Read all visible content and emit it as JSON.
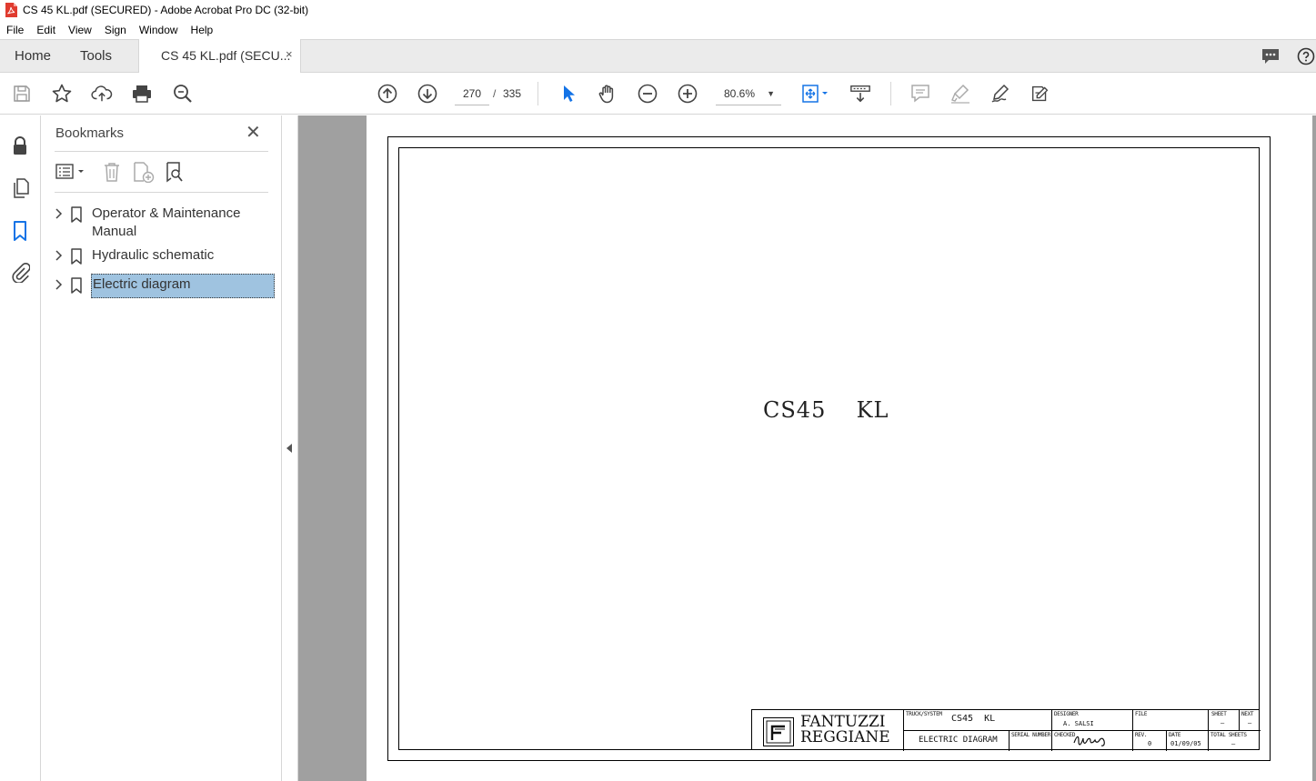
{
  "window": {
    "title": "CS 45 KL.pdf (SECURED) - Adobe Acrobat Pro DC (32-bit)"
  },
  "menu": [
    "File",
    "Edit",
    "View",
    "Sign",
    "Window",
    "Help"
  ],
  "tabs": {
    "home": "Home",
    "tools": "Tools",
    "document": "CS 45 KL.pdf (SECU...",
    "close": "×"
  },
  "toolbar": {
    "current_page": "270",
    "page_separator": "/",
    "total_pages": "335",
    "zoom": "80.6%",
    "icons": [
      "save-icon",
      "star-icon",
      "upload-icon",
      "print-icon",
      "search-zoom-icon",
      "page-up-icon",
      "page-down-icon",
      "select-arrow-icon",
      "hand-icon",
      "zoom-out-icon",
      "zoom-in-icon",
      "fit-page-icon",
      "scroll-mode-icon",
      "comment-icon",
      "highlight-icon",
      "sign-icon",
      "more-tools-icon"
    ]
  },
  "left_rail": {
    "icons": [
      "lock-icon",
      "pages-icon",
      "bookmark-icon",
      "attachment-icon"
    ]
  },
  "bookmarks": {
    "title": "Bookmarks",
    "close": "✕",
    "items": [
      {
        "label": "Operator & Maintenance Manual"
      },
      {
        "label": "Hydraulic schematic"
      },
      {
        "label": "Electric diagram",
        "selected": true
      }
    ]
  },
  "document": {
    "title": "CS45  KL",
    "title_block": {
      "company_line1": "FANTUZZI",
      "company_line2": "REGGIANE",
      "truck_label": "TRUCK/SYSTEM",
      "truck_value": "CS45  KL",
      "designer_label": "DESIGNER",
      "designer_value": "A. SALSI",
      "file_label": "FILE",
      "sheet_label": "SHEET",
      "sheet_value": "–",
      "next_label": "NEXT",
      "next_value": "–",
      "description": "ELECTRIC DIAGRAM",
      "serial_label": "SERIAL NUMBER",
      "checked_label": "CHECKED",
      "rev_label": "REV.",
      "rev_value": "0",
      "date_label": "DATE",
      "date_value": "01/09/05",
      "total_label": "TOTAL SHEETS",
      "total_value": "–"
    }
  },
  "colors": {
    "selection": "#9fc3e0",
    "accent": "#1473e6",
    "doc_background": "#a0a0a0"
  }
}
